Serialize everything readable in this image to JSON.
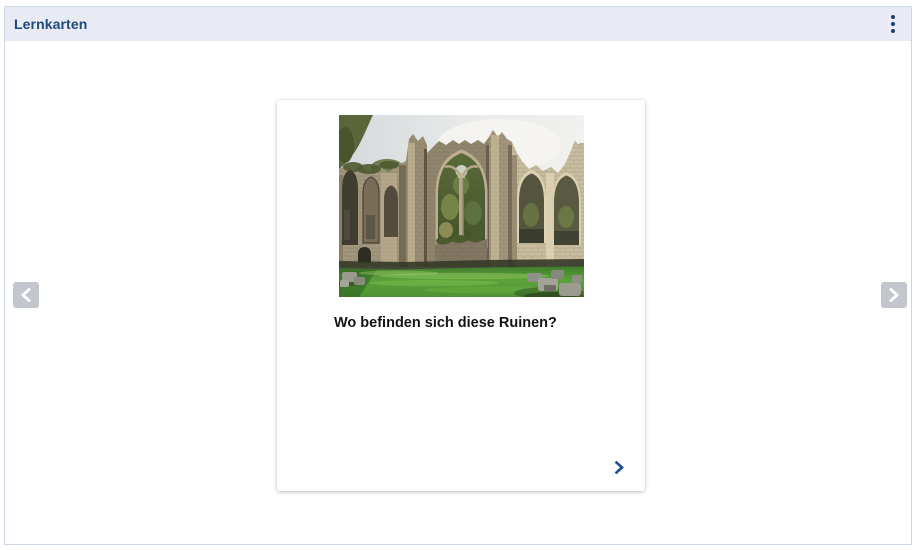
{
  "header": {
    "title": "Lernkarten",
    "menu_icon": "kebab-vertical"
  },
  "card": {
    "question": "Wo befinden sich diese Ruinen?",
    "image_description": "Foto: Ruinen einer gotischen Abtei mit Spitzbogenfenstern, Mauerresten und gruener Rasenflaeche",
    "next_icon": "chevron-right"
  },
  "navigation": {
    "prev_icon": "chevron-left",
    "next_icon": "chevron-right"
  },
  "colors": {
    "header_bg": "#e8ebf3",
    "title_text": "#1e497b",
    "kebab_dots": "#1e3e73",
    "page_border": "#ccd5e4",
    "nav_button_bg": "#c3c6cc",
    "nav_chevron": "#ffffff",
    "card_next_chevron": "#1d4f9c",
    "question_text": "#141414"
  }
}
